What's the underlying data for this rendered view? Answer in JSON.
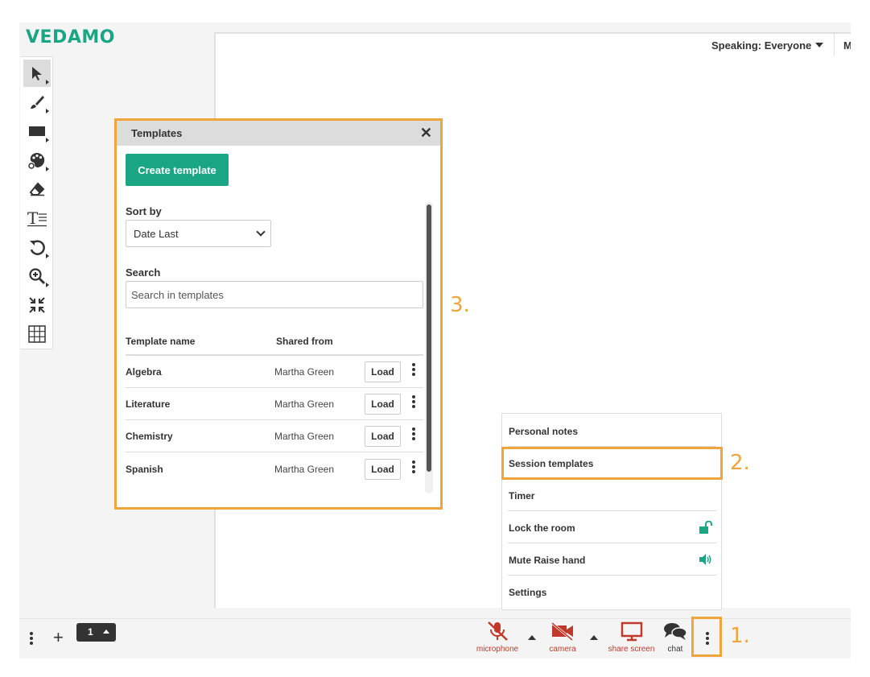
{
  "app": {
    "logo": "VEDAMO",
    "speaking": "Speaking: Everyone",
    "speaking_cut": "M"
  },
  "toolbar": {
    "tools": [
      "pointer-icon",
      "brush-icon",
      "rectangle-icon",
      "palette-icon",
      "eraser-icon",
      "text-icon",
      "undo-icon",
      "zoom-icon",
      "fit-icon",
      "grid-icon"
    ]
  },
  "templates": {
    "title": "Templates",
    "close": "✕",
    "create_label": "Create template",
    "sort_label": "Sort by",
    "sort_value": "Date Last",
    "search_label": "Search",
    "search_placeholder": "Search in templates",
    "col_name": "Template name",
    "col_shared": "Shared from",
    "rows": [
      {
        "name": "Algebra",
        "shared": "Martha Green",
        "action": "Load"
      },
      {
        "name": "Literature",
        "shared": "Martha Green",
        "action": "Load"
      },
      {
        "name": "Chemistry",
        "shared": "Martha Green",
        "action": "Load"
      },
      {
        "name": "Spanish",
        "shared": "Martha Green",
        "action": "Load"
      }
    ]
  },
  "menu": {
    "items": [
      "Personal notes",
      "Session templates",
      "Timer",
      "Lock the room",
      "Mute Raise hand",
      "Settings"
    ]
  },
  "steps": {
    "one": "1.",
    "two": "2.",
    "three": "3."
  },
  "bottom": {
    "page": "1",
    "plus": "+",
    "microphone": "microphone",
    "camera": "camera",
    "share": "share screen",
    "chat": "chat"
  },
  "colors": {
    "accent": "#1aa585",
    "highlight": "#f0a43c",
    "danger": "#c0392b"
  }
}
